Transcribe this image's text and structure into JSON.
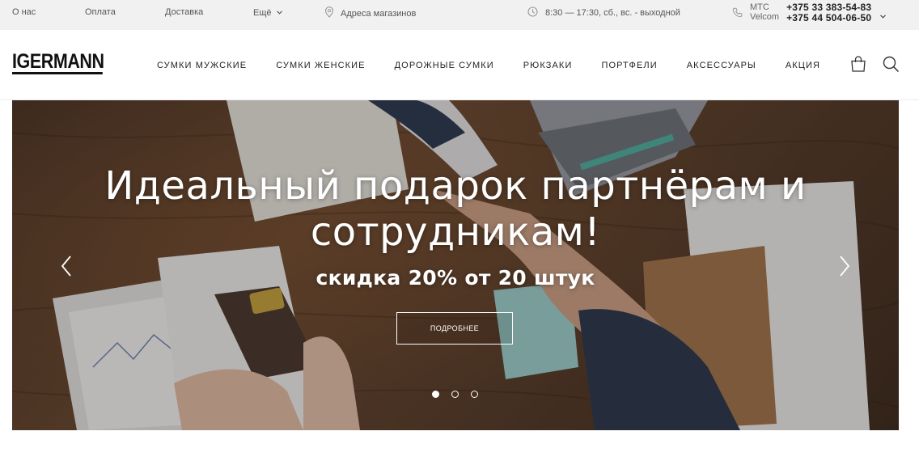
{
  "topbar": {
    "links": [
      {
        "label": "О нас"
      },
      {
        "label": "Оплата"
      },
      {
        "label": "Доставка"
      },
      {
        "label": "Ещё"
      }
    ],
    "stores_label": "Адреса магазинов",
    "hours": "8:30 — 17:30, сб., вс. - выходной",
    "phones": {
      "operator_1": "МТС",
      "operator_2": "Velcom",
      "number_1": "+375 33 383-54-83",
      "number_2": "+375 44 504-06-50"
    }
  },
  "header": {
    "logo": "IGERMANN",
    "nav": [
      {
        "label": "СУМКИ МУЖСКИЕ"
      },
      {
        "label": "СУМКИ ЖЕНСКИЕ"
      },
      {
        "label": "ДОРОЖНЫЕ СУМКИ"
      },
      {
        "label": "РЮКЗАКИ"
      },
      {
        "label": "ПОРТФЕЛИ"
      },
      {
        "label": "АКСЕССУАРЫ"
      },
      {
        "label": "АКЦИЯ"
      }
    ]
  },
  "hero": {
    "title_line_1": "Идеальный подарок партнёрам и",
    "title_line_2": "сотрудникам!",
    "subtitle": "скидка 20% от 20 штук",
    "button_label": "ПОДРОБНЕЕ",
    "slides_total": 3,
    "active_slide": 1
  },
  "colors": {
    "topbar_bg": "#f1f1f1",
    "text_dark": "#222222",
    "hero_text": "#ffffff"
  }
}
